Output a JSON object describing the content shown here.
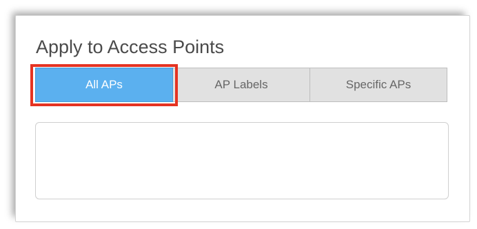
{
  "panel": {
    "title": "Apply to Access Points"
  },
  "segments": [
    {
      "label": "All APs",
      "selected": true
    },
    {
      "label": "AP Labels",
      "selected": false
    },
    {
      "label": "Specific APs",
      "selected": false
    }
  ],
  "selection_box": {
    "value": "",
    "placeholder": ""
  },
  "colors": {
    "selected_segment": "#5bb0ef",
    "unselected_segment": "#e1e1e1",
    "highlight_outline": "#e53322"
  }
}
